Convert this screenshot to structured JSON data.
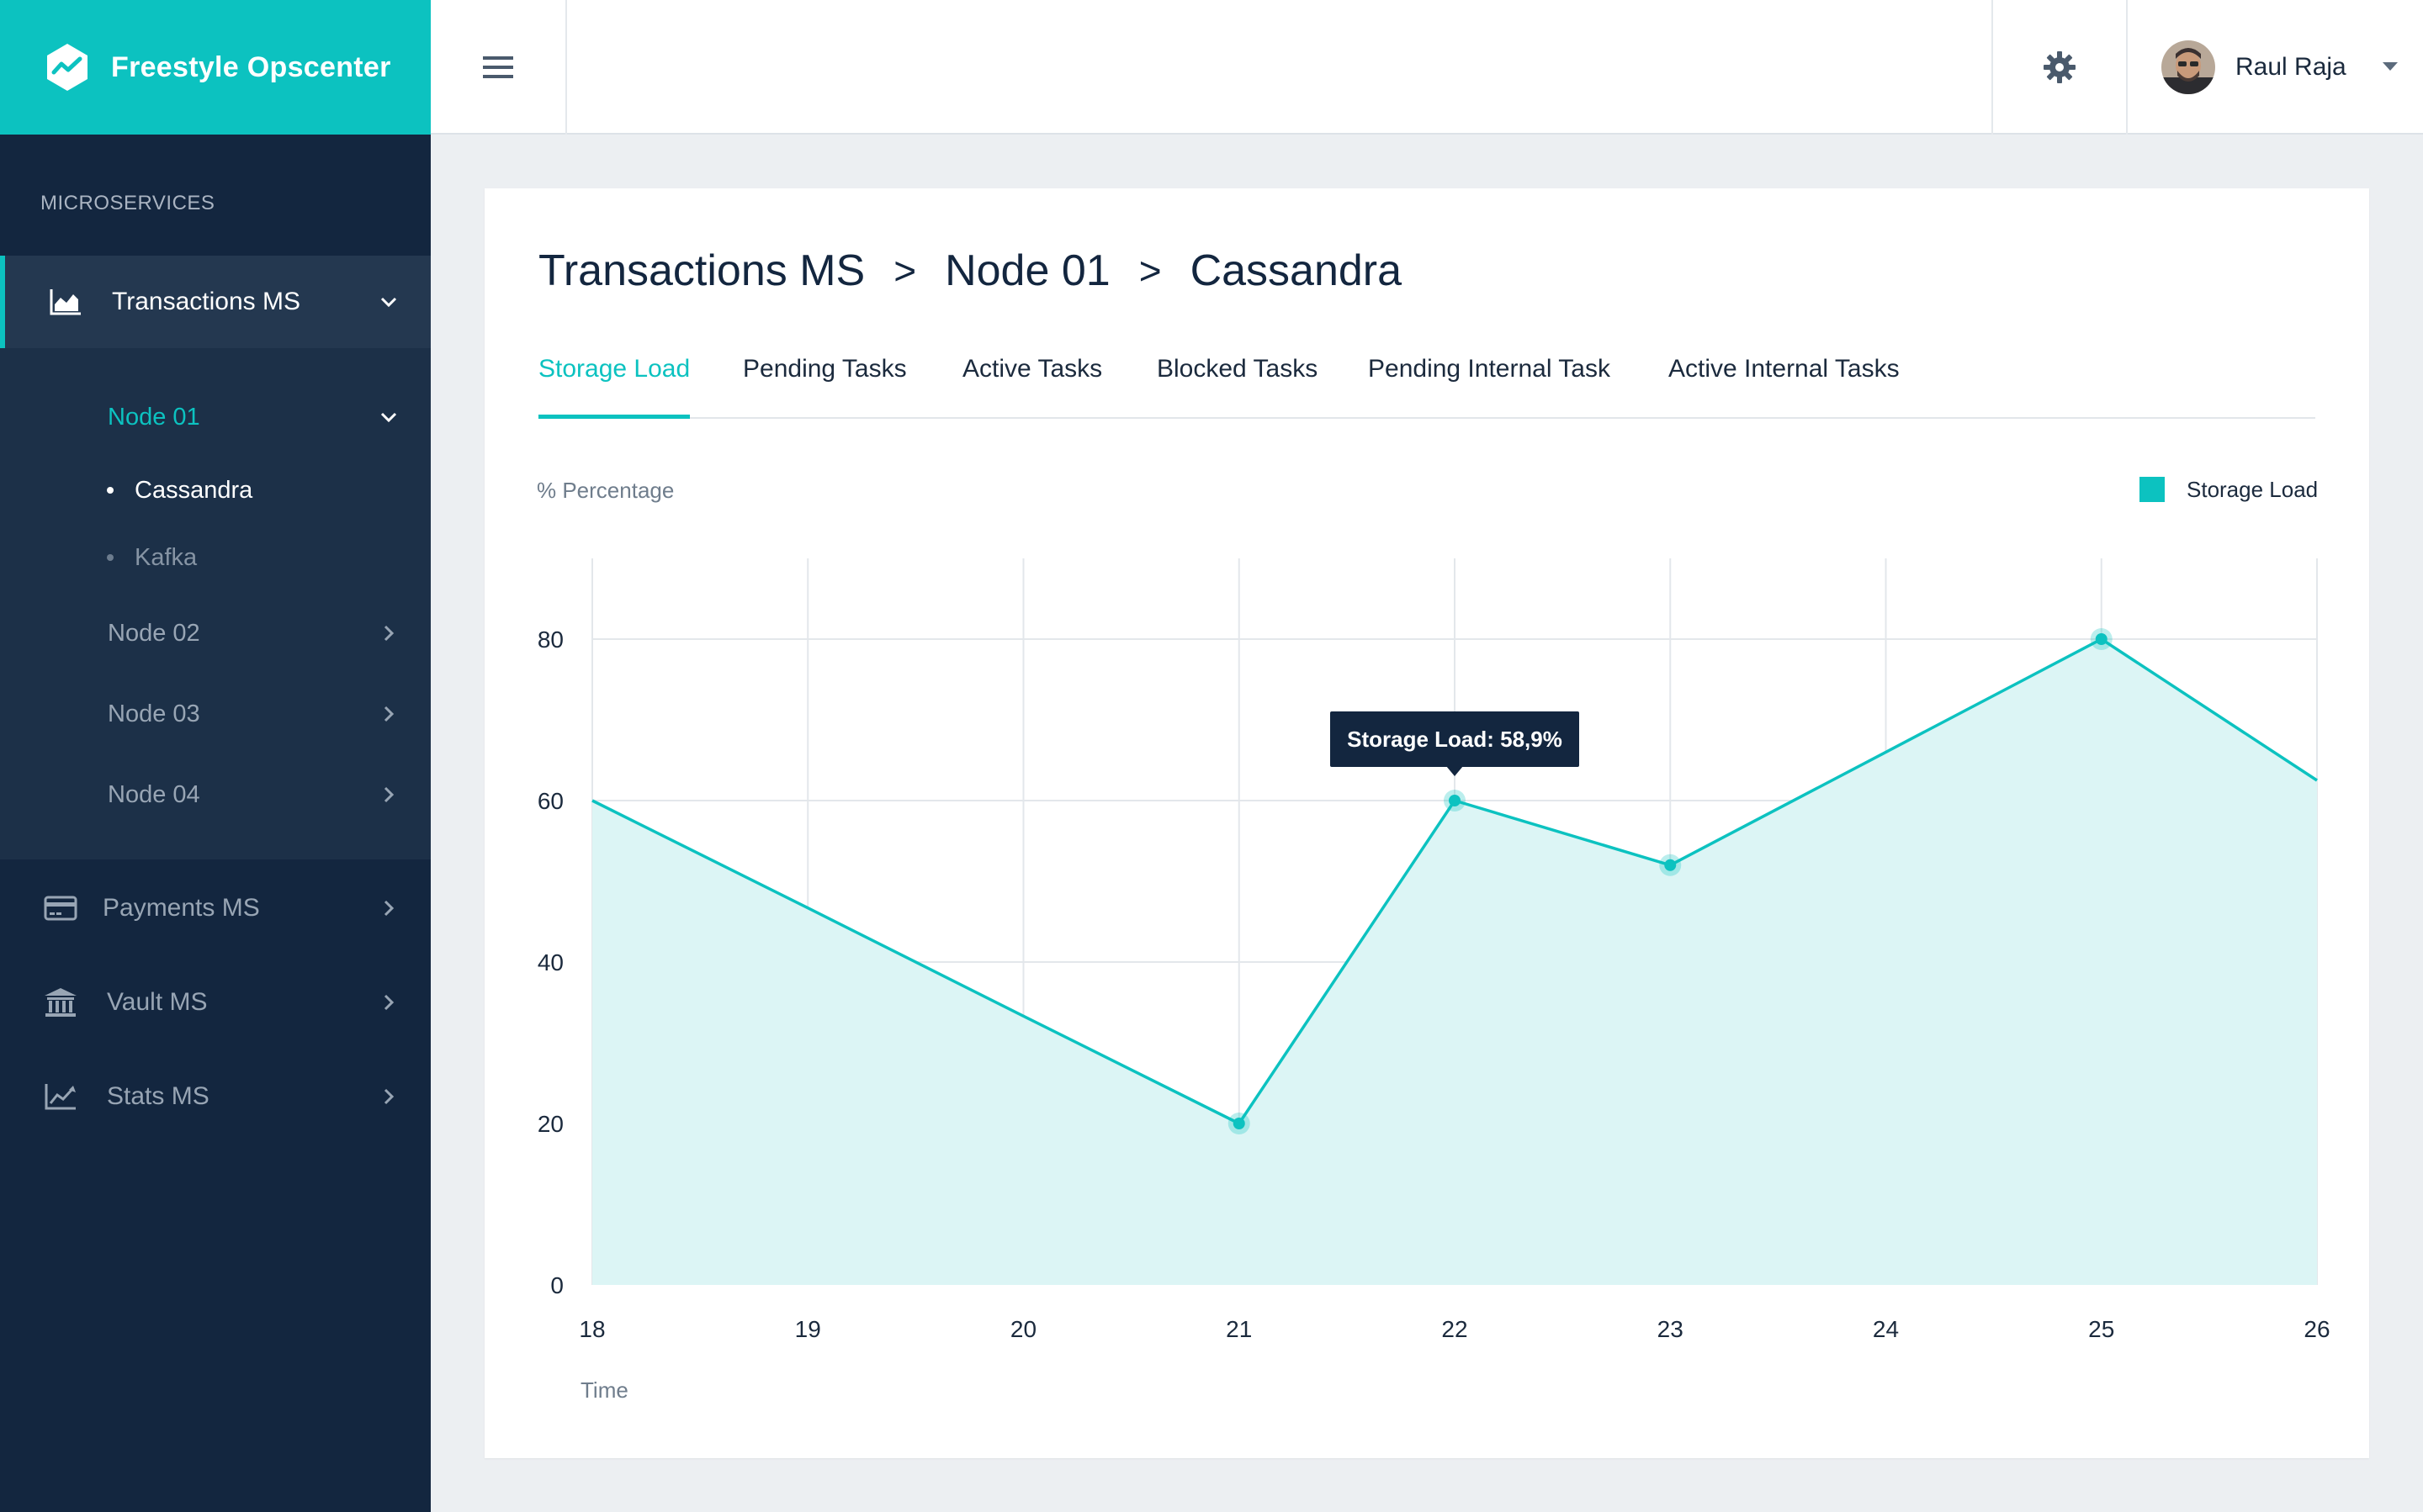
{
  "app": {
    "name": "Freestyle Opscenter"
  },
  "sidebar": {
    "section_label": "MICROSERVICES",
    "items": [
      {
        "label": "Transactions MS",
        "icon": "area-chart-icon",
        "expanded": true
      },
      {
        "label": "Payments MS",
        "icon": "credit-card-icon"
      },
      {
        "label": "Vault MS",
        "icon": "bank-icon"
      },
      {
        "label": "Stats MS",
        "icon": "line-chart-icon"
      }
    ],
    "sub_items": [
      {
        "label": "Node 01",
        "expanded": true,
        "children": [
          {
            "label": "Cassandra",
            "active": true
          },
          {
            "label": "Kafka"
          }
        ]
      },
      {
        "label": "Node 02"
      },
      {
        "label": "Node 03"
      },
      {
        "label": "Node 04"
      }
    ]
  },
  "header": {
    "menu_icon": "hamburger-icon",
    "settings_icon": "gear-icon",
    "user_name": "Raul Raja"
  },
  "breadcrumb": [
    "Transactions MS",
    "Node 01",
    "Cassandra"
  ],
  "breadcrumb_separator": ">",
  "tabs": [
    "Storage Load",
    "Pending Tasks",
    "Active Tasks",
    "Blocked Tasks",
    "Pending Internal Task",
    "Active Internal Tasks"
  ],
  "active_tab": "Storage Load",
  "colors": {
    "accent": "#0cc2c0",
    "sidebar": "#13263f",
    "fill": "#dcf5f5",
    "tooltip": "#13263f"
  },
  "chart_data": {
    "type": "area",
    "ylabel": "% Percentage",
    "xlabel": "Time",
    "x": [
      18,
      19,
      20,
      21,
      22,
      23,
      24,
      25,
      26
    ],
    "series": [
      {
        "name": "Storage Load",
        "values": [
          60,
          46.7,
          33.3,
          20,
          60,
          52,
          66,
          80,
          62.5
        ]
      }
    ],
    "marked_points_x": [
      21,
      22,
      23,
      25
    ],
    "ylim": [
      0,
      90
    ],
    "yticks": [
      0,
      20,
      40,
      60,
      80
    ],
    "grid": true,
    "legend_position": "top-right",
    "tooltip": {
      "x": 22,
      "text": "Storage Load: 58,9%"
    }
  }
}
